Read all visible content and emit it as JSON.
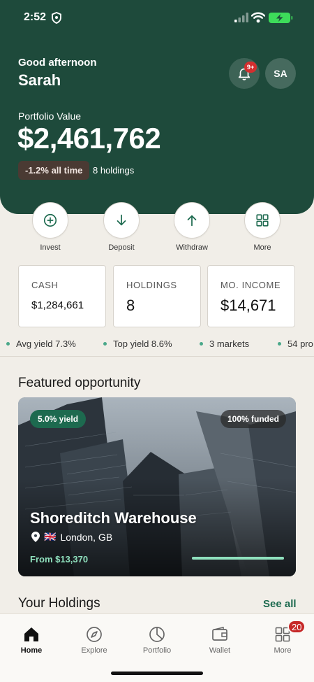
{
  "status": {
    "time": "2:52"
  },
  "header": {
    "greeting": "Good afternoon",
    "user_name": "Sarah",
    "notifications_badge": "9+",
    "avatar_initials": "SA"
  },
  "portfolio": {
    "label": "Portfolio Value",
    "value": "$2,461,762",
    "change": "-1.2% all time",
    "holdings": "8 holdings"
  },
  "actions": [
    {
      "label": "Invest",
      "icon": "plus-circle-icon"
    },
    {
      "label": "Deposit",
      "icon": "arrow-down-icon"
    },
    {
      "label": "Withdraw",
      "icon": "arrow-up-icon"
    },
    {
      "label": "More",
      "icon": "grid-icon"
    }
  ],
  "stats": [
    {
      "label": "CASH",
      "value": "$1,284,661"
    },
    {
      "label": "HOLDINGS",
      "value": "8"
    },
    {
      "label": "MO. INCOME",
      "value": "$14,671"
    }
  ],
  "ticker": [
    "Avg yield 7.3%",
    "Top yield 8.6%",
    "3 markets",
    "54 pro"
  ],
  "featured": {
    "section_title": "Featured opportunity",
    "yield": "5.0% yield",
    "funded": "100% funded",
    "title": "Shoreditch Warehouse",
    "flag": "🇬🇧",
    "location": "London, GB",
    "price": "From $13,370",
    "funded_progress": 1.0
  },
  "holdings_section": {
    "title": "Your Holdings",
    "see_all": "See all"
  },
  "tabs": [
    {
      "label": "Home",
      "icon": "home-icon",
      "active": true
    },
    {
      "label": "Explore",
      "icon": "compass-icon"
    },
    {
      "label": "Portfolio",
      "icon": "pie-chart-icon"
    },
    {
      "label": "Wallet",
      "icon": "wallet-icon"
    },
    {
      "label": "More",
      "icon": "grid-icon",
      "badge": "20"
    }
  ],
  "colors": {
    "hero": "#1e4a3b",
    "accent": "#1d6a4f",
    "accent_light": "#8fe0bd",
    "badge_red": "#d32f2f",
    "background": "#f1eee8"
  }
}
